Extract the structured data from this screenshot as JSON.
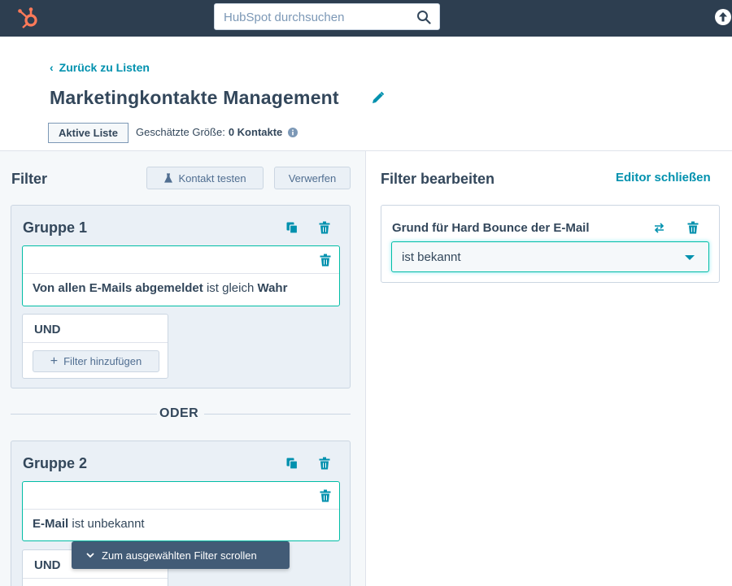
{
  "nav": {
    "search_placeholder": "HubSpot durchsuchen"
  },
  "header": {
    "back_link": "Zurück zu Listen",
    "title": "Marketingkontakte Management",
    "status_badge": "Aktive Liste",
    "size_label": "Geschätzte Größe:",
    "size_value": "0 Kontakte"
  },
  "filter_panel": {
    "title": "Filter",
    "test_contact_button": "Kontakt testen",
    "discard_button": "Verwerfen",
    "or_separator": "ODER",
    "groups": [
      {
        "title": "Gruppe 1",
        "filter": {
          "property": "Von allen E-Mails abgemeldet",
          "operator": "ist gleich",
          "value": "Wahr"
        },
        "and_label": "UND",
        "add_filter_button": "Filter hinzufügen"
      },
      {
        "title": "Gruppe 2",
        "filter": {
          "property": "E-Mail",
          "operator": "ist unbekannt",
          "value": ""
        },
        "and_label": "UND"
      }
    ],
    "scroll_tooltip": "Zum ausgewählten Filter scrollen"
  },
  "editor_panel": {
    "title": "Filter bearbeiten",
    "close_link": "Editor schließen",
    "property_name": "Grund für Hard Bounce der E-Mail",
    "selected_operator": "ist bekannt"
  },
  "colors": {
    "nav_bg": "#2d3e50",
    "accent_teal": "#0091ae",
    "focus_border": "#00bda5",
    "logo_orange": "#ff7a59"
  },
  "icons": [
    "hubspot-logo",
    "search-icon",
    "upgrade-icon",
    "pencil-icon",
    "info-icon",
    "flask-icon",
    "clone-icon",
    "trash-icon",
    "plus-icon",
    "swap-icon",
    "chevron-down-icon",
    "chevron-left-icon"
  ]
}
